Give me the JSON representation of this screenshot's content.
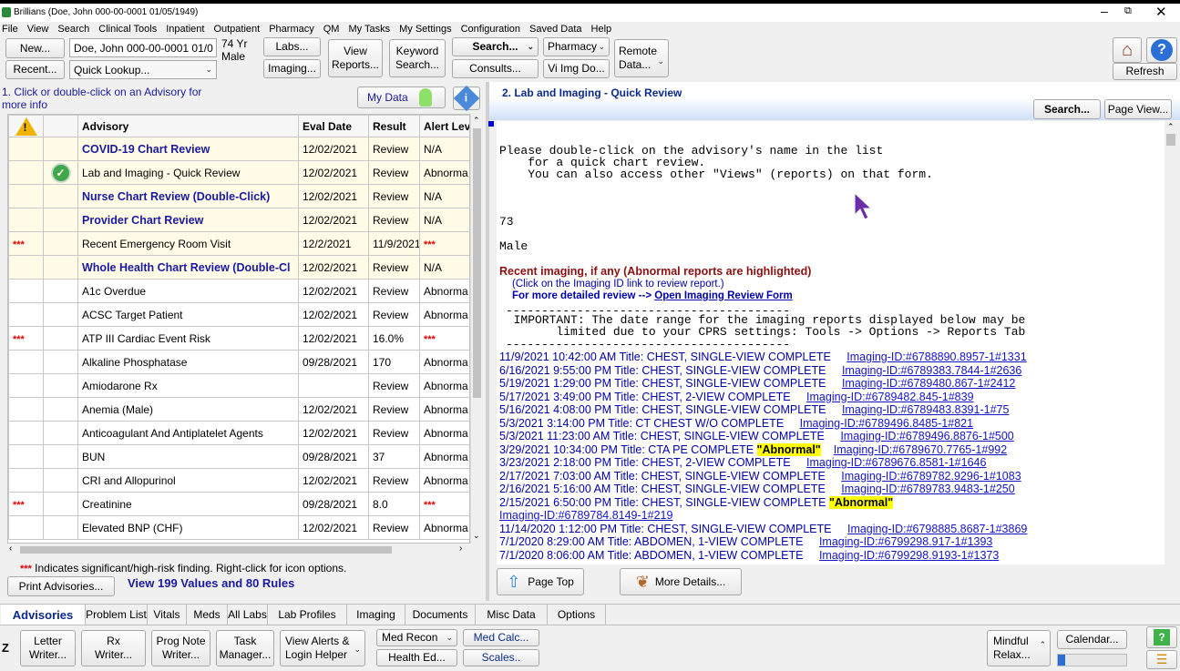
{
  "title": "Brillians (Doe, John 000-00-0001 01/05/1949)",
  "menu": [
    "File",
    "View",
    "Search",
    "Clinical Tools",
    "Inpatient",
    "Outpatient",
    "Pharmacy",
    "QM",
    "My Tasks",
    "My Settings",
    "Configuration",
    "Saved Data",
    "Help"
  ],
  "toolbar": {
    "new": "New...",
    "recent": "Recent...",
    "patient_field": "Doe, John  000-00-0001  01/0",
    "age": "74 Yr",
    "sex": "Male",
    "quick_lookup": "Quick Lookup...",
    "labs": "Labs...",
    "imaging": "Imaging...",
    "view_reports_1": "View",
    "view_reports_2": "Reports...",
    "keyword_1": "Keyword",
    "keyword_2": "Search...",
    "search": "Search...",
    "consults": "Consults...",
    "pharmacy": "Pharmacy",
    "vi_img": "Vi Img Do...",
    "remote_1": "Remote",
    "remote_2": "Data...",
    "refresh": "Refresh"
  },
  "left": {
    "instruction": "1. Click or double-click on an Advisory for more info",
    "my_data": "My Data",
    "columns": [
      "Advisory",
      "Eval Date",
      "Result",
      "Alert Lev"
    ],
    "rows": [
      {
        "stars": "",
        "check": false,
        "name": "COVID-19 Chart Review",
        "date": "12/02/2021",
        "result": "Review",
        "alert": "N/A",
        "bold": true,
        "hl": true
      },
      {
        "stars": "",
        "check": true,
        "name": "Lab and Imaging - Quick Review",
        "date": "12/02/2021",
        "result": "Review",
        "alert": "Abnorma",
        "bold": false,
        "hl": true
      },
      {
        "stars": "",
        "check": false,
        "name": "Nurse Chart Review (Double-Click)",
        "date": "12/02/2021",
        "result": "Review",
        "alert": "N/A",
        "bold": true,
        "hl": true
      },
      {
        "stars": "",
        "check": false,
        "name": "Provider Chart Review",
        "date": "12/02/2021",
        "result": "Review",
        "alert": "N/A",
        "bold": true,
        "hl": true
      },
      {
        "stars": "***",
        "check": false,
        "name": "Recent Emergency Room Visit",
        "date": "12/2/2021",
        "result": "11/9/2021",
        "alert": "***",
        "bold": false,
        "hl": true
      },
      {
        "stars": "",
        "check": false,
        "name": "Whole Health Chart Review (Double-Cl",
        "date": "12/02/2021",
        "result": "Review",
        "alert": "N/A",
        "bold": true,
        "hl": true
      },
      {
        "stars": "",
        "check": false,
        "name": "A1c Overdue",
        "date": "12/02/2021",
        "result": "Review",
        "alert": "Abnorma",
        "bold": false,
        "hl": false
      },
      {
        "stars": "",
        "check": false,
        "name": "ACSC Target Patient",
        "date": "12/02/2021",
        "result": "Review",
        "alert": "Abnorma",
        "bold": false,
        "hl": false
      },
      {
        "stars": "***",
        "check": false,
        "name": "ATP III Cardiac Event Risk",
        "date": "12/02/2021",
        "result": "16.0%",
        "alert": "***",
        "bold": false,
        "hl": false
      },
      {
        "stars": "",
        "check": false,
        "name": "Alkaline Phosphatase",
        "date": "09/28/2021",
        "result": "170",
        "alert": "Abnorma",
        "bold": false,
        "hl": false
      },
      {
        "stars": "",
        "check": false,
        "name": "Amiodarone Rx",
        "date": "",
        "result": "Review",
        "alert": "Abnorma",
        "bold": false,
        "hl": false
      },
      {
        "stars": "",
        "check": false,
        "name": "Anemia (Male)",
        "date": "12/02/2021",
        "result": "Review",
        "alert": "Abnorma",
        "bold": false,
        "hl": false
      },
      {
        "stars": "",
        "check": false,
        "name": "Anticoagulant And Antiplatelet Agents",
        "date": "12/02/2021",
        "result": "Review",
        "alert": "Abnorma",
        "bold": false,
        "hl": false
      },
      {
        "stars": "",
        "check": false,
        "name": "BUN",
        "date": "09/28/2021",
        "result": "37",
        "alert": "Abnorma",
        "bold": false,
        "hl": false
      },
      {
        "stars": "",
        "check": false,
        "name": "CRI and Allopurinol",
        "date": "12/02/2021",
        "result": "Review",
        "alert": "Abnorma",
        "bold": false,
        "hl": false
      },
      {
        "stars": "***",
        "check": false,
        "name": "Creatinine",
        "date": "09/28/2021",
        "result": "8.0",
        "alert": "***",
        "bold": false,
        "hl": false
      },
      {
        "stars": "",
        "check": false,
        "name": "Elevated BNP (CHF)",
        "date": "12/02/2021",
        "result": "Review",
        "alert": "Abnorma",
        "bold": false,
        "hl": false
      }
    ],
    "footnote_stars": "***",
    "footnote": " Indicates significant/high-risk finding. Right-click for icon options.",
    "print": "Print Advisories...",
    "view_values": "View 199 Values and 80 Rules"
  },
  "right": {
    "header": "2.  Lab and Imaging - Quick Review",
    "search": "Search...",
    "page_view": "Page View...",
    "intro": "Please double-click on the advisory's name in the list\n    for a quick chart review.\n    You can also access other \"Views\" (reports) on that form.",
    "age": "73",
    "sex": "Male",
    "imaging_title": "Recent imaging, if any (Abnormal reports are highlighted)",
    "imaging_hint": "(Click on the Imaging ID link to review report.)",
    "detail_prefix": "For more detailed review --> ",
    "detail_link": "Open Imaging Review Form",
    "dash": "----------------------------------------",
    "important": "  IMPORTANT: The date range for the imaging reports displayed below may be\n        limited due to your CPRS settings: Tools -> Options -> Reports Tab",
    "entries": [
      {
        "text": "11/9/2021 10:42:00 AM  Title:  CHEST, SINGLE-VIEW  COMPLETE  ",
        "abn": "",
        "link": "Imaging-ID:#6788890.8957-1#1331"
      },
      {
        "text": "6/16/2021 9:55:00 PM  Title:  CHEST, SINGLE-VIEW  COMPLETE  ",
        "abn": "",
        "link": "Imaging-ID:#6789383.7844-1#2636"
      },
      {
        "text": "5/19/2021 1:29:00 PM  Title:  CHEST, SINGLE-VIEW  COMPLETE  ",
        "abn": "",
        "link": "Imaging-ID:#6789480.867-1#2412"
      },
      {
        "text": "5/17/2021 3:49:00 PM  Title:  CHEST, 2-VIEW  COMPLETE  ",
        "abn": "",
        "link": "Imaging-ID:#6789482.845-1#839"
      },
      {
        "text": "5/16/2021 4:08:00 PM  Title:  CHEST, SINGLE-VIEW  COMPLETE  ",
        "abn": "",
        "link": "Imaging-ID:#6789483.8391-1#75"
      },
      {
        "text": "5/3/2021 3:14:00 PM  Title:  CT CHEST W/O  COMPLETE  ",
        "abn": "",
        "link": "Imaging-ID:#6789496.8485-1#821"
      },
      {
        "text": "5/3/2021 11:23:00 AM  Title:  CHEST, SINGLE-VIEW  COMPLETE  ",
        "abn": "",
        "link": "Imaging-ID:#6789496.8876-1#500"
      },
      {
        "text": "3/29/2021 10:34:00 PM  Title:  CTA PE  COMPLETE  ",
        "abn": "\"Abnormal\"",
        "link": "Imaging-ID:#6789670.7765-1#992"
      },
      {
        "text": "3/23/2021 2:18:00 PM  Title:  CHEST, 2-VIEW  COMPLETE  ",
        "abn": "",
        "link": "Imaging-ID:#6789676.8581-1#1646"
      },
      {
        "text": "2/17/2021 7:03:00 AM  Title:  CHEST, SINGLE-VIEW  COMPLETE  ",
        "abn": "",
        "link": "Imaging-ID:#6789782.9296-1#1083"
      },
      {
        "text": "2/16/2021 5:16:00 AM  Title:  CHEST, SINGLE-VIEW  COMPLETE  ",
        "abn": "",
        "link": "Imaging-ID:#6789783.9483-1#250"
      },
      {
        "text": "2/15/2021 6:50:00 PM  Title:  CHEST, SINGLE-VIEW  COMPLETE  ",
        "abn": "\"Abnormal\"",
        "link": ""
      },
      {
        "text": "",
        "abn": "",
        "link": "Imaging-ID:#6789784.8149-1#219"
      },
      {
        "text": "11/14/2020 1:12:00 PM  Title:  CHEST, SINGLE-VIEW  COMPLETE  ",
        "abn": "",
        "link": "Imaging-ID:#6798885.8687-1#3869"
      },
      {
        "text": "7/1/2020 8:29:00 AM  Title:  ABDOMEN, 1-VIEW  COMPLETE  ",
        "abn": "",
        "link": "Imaging-ID:#6799298.917-1#1393"
      },
      {
        "text": "7/1/2020 8:06:00 AM  Title:  ABDOMEN, 1-VIEW  COMPLETE  ",
        "abn": "",
        "link": "Imaging-ID:#6799298.9193-1#1373"
      }
    ],
    "page_top": "Page Top",
    "more_details": "More Details..."
  },
  "tabs": [
    "Advisories",
    "Problem List",
    "Vitals",
    "Meds",
    "All Labs",
    "Lab Profiles",
    "Imaging",
    "Documents",
    "Misc Data",
    "Options"
  ],
  "bottom": {
    "z": "Z",
    "letter_1": "Letter",
    "letter_2": "Writer...",
    "rx_1": "Rx",
    "rx_2": "Writer...",
    "prog_1": "Prog Note",
    "prog_2": "Writer...",
    "task_1": "Task",
    "task_2": "Manager...",
    "alerts_1": "View Alerts &",
    "alerts_2": "Login Helper",
    "med_recon": "Med Recon",
    "health_ed": "Health Ed...",
    "med_calc": "Med Calc...",
    "scales": "Scales..",
    "mindful_1": "Mindful",
    "mindful_2": "Relax...",
    "calendar": "Calendar..."
  }
}
